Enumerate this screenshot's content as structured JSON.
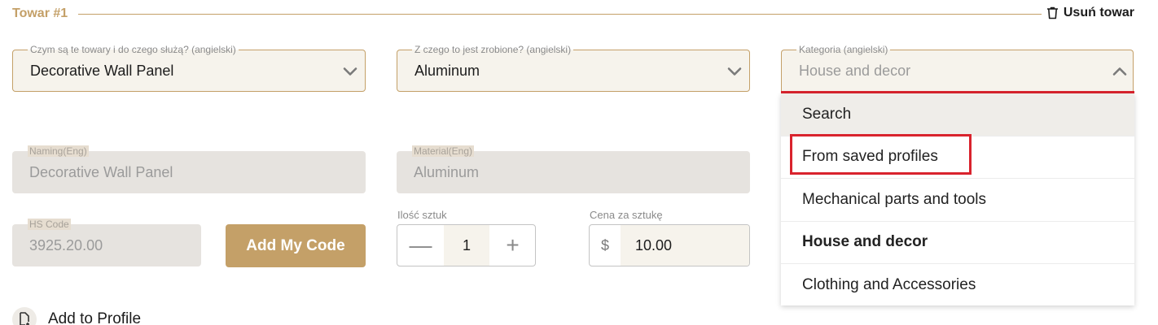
{
  "header": {
    "title": "Towar #1",
    "remove_label": "Usuń towar"
  },
  "fields": {
    "what_goods": {
      "legend": "Czym są te towary i do czego służą? (angielski)",
      "value": "Decorative Wall Panel"
    },
    "made_of": {
      "legend": "Z czego to jest zrobione? (angielski)",
      "value": "Aluminum"
    },
    "category": {
      "legend": "Kategoria (angielski)",
      "value": "House and decor"
    }
  },
  "readonly": {
    "naming": {
      "label": "Naming(Eng)",
      "value": "Decorative Wall Panel"
    },
    "material": {
      "label": "Material(Eng)",
      "value": "Aluminum"
    },
    "hs_code": {
      "label": "HS Code",
      "value": "3925.20.00"
    }
  },
  "buttons": {
    "add_code": "Add My Code",
    "add_profile": "Add to Profile"
  },
  "quantity": {
    "label": "Ilość sztuk",
    "value": "1",
    "minus": "—",
    "plus": "+"
  },
  "price": {
    "label": "Cena za sztukę",
    "currency": "$",
    "value": "10.00"
  },
  "menu": {
    "items": [
      {
        "label": "Search"
      },
      {
        "label": "From saved profiles"
      },
      {
        "label": "Mechanical parts and tools"
      },
      {
        "label": "House and decor"
      },
      {
        "label": "Clothing and Accessories"
      }
    ]
  },
  "colors": {
    "accent": "#c4a068",
    "highlight": "#d9232d",
    "field_bg": "#f6f3ec",
    "readonly_bg": "#e6e3df"
  },
  "icons": {
    "remove": "trash-icon",
    "dropdown": "chevron-down-icon",
    "dropdown_open": "chevron-up-icon",
    "add_profile": "document-add-icon"
  }
}
